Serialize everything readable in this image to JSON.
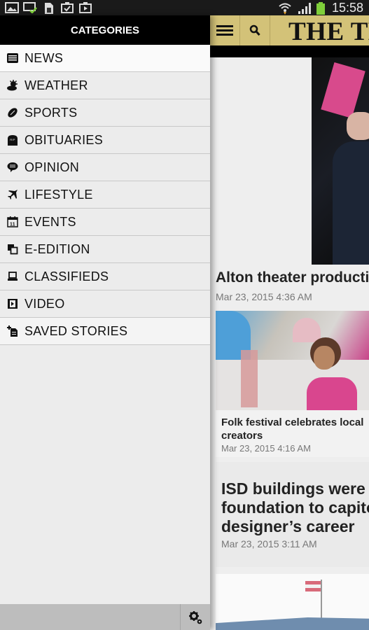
{
  "status_bar": {
    "time": "15:58",
    "icons": [
      "gallery-icon",
      "cast-check-icon",
      "sim-card-icon",
      "clipboard-check-icon",
      "media-bag-icon",
      "wifi-icon",
      "signal-icon",
      "battery-icon"
    ]
  },
  "drawer": {
    "title": "CATEGORIES",
    "items": [
      {
        "label": "NEWS",
        "icon": "newspaper-icon"
      },
      {
        "label": "WEATHER",
        "icon": "weather-icon"
      },
      {
        "label": "SPORTS",
        "icon": "football-icon"
      },
      {
        "label": "OBITUARIES",
        "icon": "tombstone-icon"
      },
      {
        "label": "OPINION",
        "icon": "speech-bubble-icon"
      },
      {
        "label": "LIFESTYLE",
        "icon": "airplane-icon"
      },
      {
        "label": "EVENTS",
        "icon": "calendar-icon"
      },
      {
        "label": "E-EDITION",
        "icon": "pages-icon"
      },
      {
        "label": "CLASSIFIEDS",
        "icon": "laptop-icon"
      },
      {
        "label": "VIDEO",
        "icon": "film-play-icon"
      },
      {
        "label": "SAVED STORIES",
        "icon": "add-bookmark-icon"
      }
    ],
    "calendar_day": "11",
    "footer": {
      "settings_icon": "gears-icon"
    }
  },
  "app_bar": {
    "menu_icon": "hamburger-icon",
    "search_icon": "search-icon",
    "masthead": "THE TELEGRAPH"
  },
  "articles": [
    {
      "title": "Alton theater production",
      "date": "Mar 23, 2015 4:36 AM"
    },
    {
      "title": "Folk festival celebrates local creators",
      "date": "Mar 23, 2015 4:16 AM"
    },
    {
      "title": "ISD buildings were foundation to capitol designer's career",
      "title_lines": [
        "ISD buildings were",
        "foundation to capitol",
        "designer’s career"
      ],
      "date": "Mar 23, 2015 3:11 AM"
    }
  ],
  "colors": {
    "app_bar": "#d3c278",
    "drawer_header": "#000000",
    "drawer_bg": "#ececec",
    "footer": "#bdbdbd"
  }
}
